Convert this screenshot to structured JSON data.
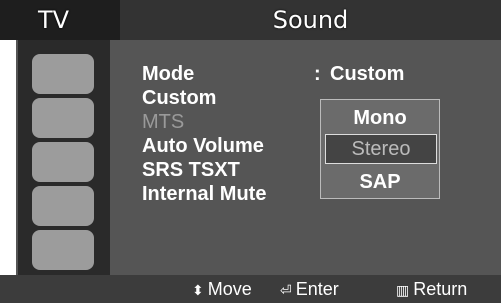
{
  "header": {
    "tv_label": "TV",
    "sound_label": "Sound"
  },
  "menu": {
    "rows": [
      {
        "label": "Mode"
      },
      {
        "label": "Custom"
      },
      {
        "label": "MTS"
      },
      {
        "label": "Auto Volume"
      },
      {
        "label": "SRS TSXT"
      },
      {
        "label": "Internal Mute"
      }
    ],
    "mode_value": "Custom",
    "colon": ":"
  },
  "popup": {
    "options": [
      "Mono",
      "Stereo",
      "SAP"
    ],
    "selected": "Stereo"
  },
  "footer": {
    "move_label": "Move",
    "enter_label": "Enter",
    "return_label": "Return"
  },
  "icons": [
    "picture-icon",
    "sound-icon",
    "channel-icon",
    "setup-icon",
    "input-icon"
  ],
  "colors": {
    "background": "#555555",
    "text": "#ffffff",
    "dim_text": "#9a9a9a"
  }
}
